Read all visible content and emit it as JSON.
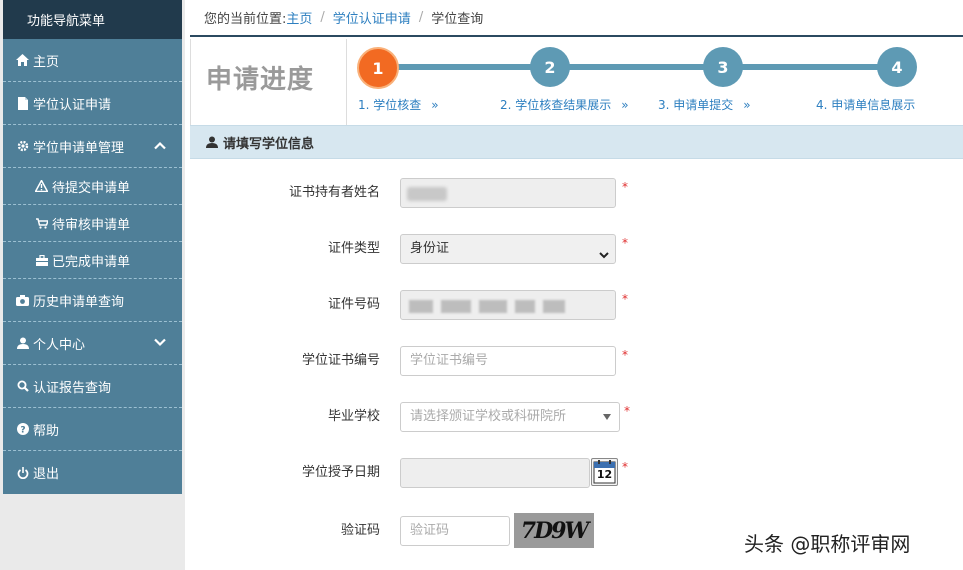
{
  "sidebar": {
    "title": "功能导航菜单",
    "items": [
      {
        "label": "主页",
        "icon": "home-icon"
      },
      {
        "label": "学位认证申请",
        "icon": "file-icon"
      },
      {
        "label": "学位申请单管理",
        "icon": "gear-icon",
        "expanded": true
      },
      {
        "label": "待提交申请单",
        "icon": "warning-icon"
      },
      {
        "label": "待审核申请单",
        "icon": "cart-icon"
      },
      {
        "label": "已完成申请单",
        "icon": "briefcase-icon"
      },
      {
        "label": "历史申请单查询",
        "icon": "camera-icon"
      },
      {
        "label": "个人中心",
        "icon": "user-icon",
        "expanded": false
      },
      {
        "label": "认证报告查询",
        "icon": "search-icon"
      },
      {
        "label": "帮助",
        "icon": "question-icon"
      },
      {
        "label": "退出",
        "icon": "power-icon"
      }
    ]
  },
  "breadcrumb": {
    "prefix": "您的当前位置:",
    "items": [
      "主页",
      "学位认证申请",
      "学位查询"
    ],
    "separator": "/"
  },
  "progress": {
    "title": "申请进度",
    "active_step": 1,
    "steps": [
      {
        "number": "1",
        "label": "1. 学位核查"
      },
      {
        "number": "2",
        "label": "2. 学位核查结果展示"
      },
      {
        "number": "3",
        "label": "3. 申请单提交"
      },
      {
        "number": "4",
        "label": "4. 申请单信息展示"
      }
    ],
    "arrow": "»"
  },
  "section": {
    "title": "请填写学位信息"
  },
  "form": {
    "holder_name": {
      "label": "证书持有者姓名"
    },
    "id_type": {
      "label": "证件类型",
      "value": "身份证"
    },
    "id_number": {
      "label": "证件号码"
    },
    "cert_number": {
      "label": "学位证书编号",
      "placeholder": "学位证书编号"
    },
    "school": {
      "label": "毕业学校",
      "placeholder": "请选择颁证学校或科研院所"
    },
    "grant_date": {
      "label": "学位授予日期",
      "calendar_text": "12"
    },
    "captcha": {
      "label": "验证码",
      "placeholder": "验证码",
      "image_text": "7D9W"
    },
    "required_mark": "*"
  },
  "colors": {
    "sidebar_bg": "#4f7f98",
    "sidebar_header_bg": "#213a4c",
    "step_active": "#f26a22",
    "step_inactive": "#5e9ab4",
    "link": "#2d7fc0",
    "required": "#e03030"
  },
  "watermark": "头条 @职称评审网"
}
